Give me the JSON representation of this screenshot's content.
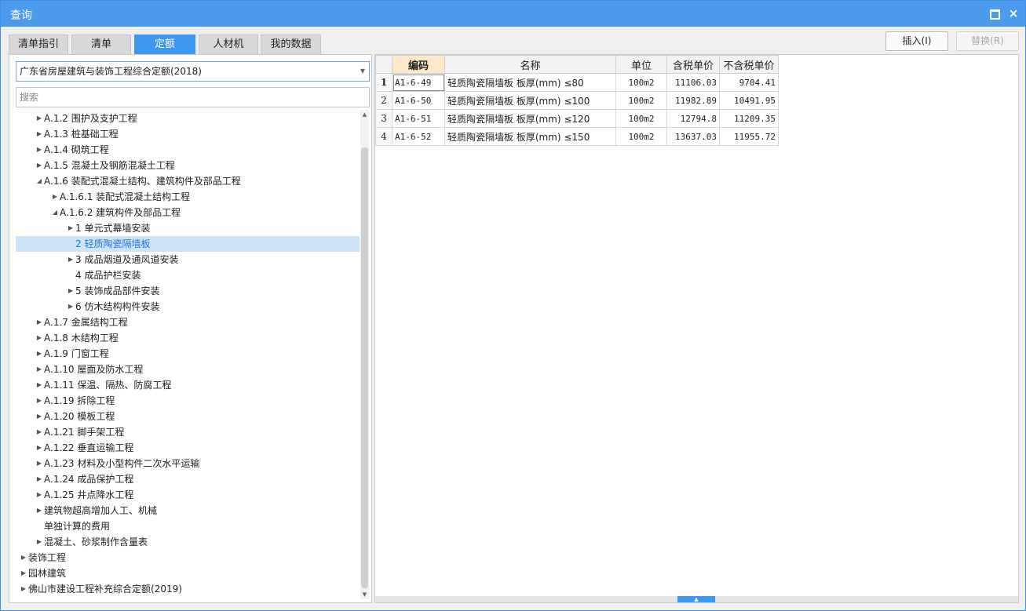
{
  "window": {
    "title": "查询",
    "close_glyph": "×"
  },
  "tabs": [
    {
      "label": "清单指引"
    },
    {
      "label": "清单"
    },
    {
      "label": "定额"
    },
    {
      "label": "人材机"
    },
    {
      "label": "我的数据"
    }
  ],
  "active_tab": "定额",
  "actions": {
    "insert_label": "插入(I)",
    "replace_label": "替换(R)"
  },
  "library": {
    "selected": "广东省房屋建筑与装饰工程综合定额(2018)"
  },
  "search": {
    "placeholder": "搜索",
    "value": ""
  },
  "tree": [
    {
      "label": "A.1.2 围护及支护工程",
      "level": 1,
      "toggle": "collapsed"
    },
    {
      "label": "A.1.3 桩基础工程",
      "level": 1,
      "toggle": "collapsed"
    },
    {
      "label": "A.1.4 砌筑工程",
      "level": 1,
      "toggle": "collapsed"
    },
    {
      "label": "A.1.5 混凝土及钢筋混凝土工程",
      "level": 1,
      "toggle": "collapsed"
    },
    {
      "label": "A.1.6 装配式混凝土结构、建筑构件及部品工程",
      "level": 1,
      "toggle": "expanded"
    },
    {
      "label": "A.1.6.1 装配式混凝土结构工程",
      "level": 2,
      "toggle": "collapsed"
    },
    {
      "label": "A.1.6.2 建筑构件及部品工程",
      "level": 2,
      "toggle": "expanded"
    },
    {
      "label": "1 单元式幕墙安装",
      "level": 3,
      "toggle": "collapsed"
    },
    {
      "label": "2 轻质陶瓷隔墙板",
      "level": 3,
      "toggle": "none",
      "selected": true
    },
    {
      "label": "3 成品烟道及通风道安装",
      "level": 3,
      "toggle": "collapsed"
    },
    {
      "label": "4 成品护栏安装",
      "level": 3,
      "toggle": "none"
    },
    {
      "label": "5 装饰成品部件安装",
      "level": 3,
      "toggle": "collapsed"
    },
    {
      "label": "6 仿木结构构件安装",
      "level": 3,
      "toggle": "collapsed"
    },
    {
      "label": "A.1.7 金属结构工程",
      "level": 1,
      "toggle": "collapsed"
    },
    {
      "label": "A.1.8 木结构工程",
      "level": 1,
      "toggle": "collapsed"
    },
    {
      "label": "A.1.9 门窗工程",
      "level": 1,
      "toggle": "collapsed"
    },
    {
      "label": "A.1.10 屋面及防水工程",
      "level": 1,
      "toggle": "collapsed"
    },
    {
      "label": "A.1.11 保温、隔热、防腐工程",
      "level": 1,
      "toggle": "collapsed"
    },
    {
      "label": "A.1.19 拆除工程",
      "level": 1,
      "toggle": "collapsed"
    },
    {
      "label": "A.1.20 模板工程",
      "level": 1,
      "toggle": "collapsed"
    },
    {
      "label": "A.1.21 脚手架工程",
      "level": 1,
      "toggle": "collapsed"
    },
    {
      "label": "A.1.22 垂直运输工程",
      "level": 1,
      "toggle": "collapsed"
    },
    {
      "label": "A.1.23 材料及小型构件二次水平运输",
      "level": 1,
      "toggle": "collapsed"
    },
    {
      "label": "A.1.24 成品保护工程",
      "level": 1,
      "toggle": "collapsed"
    },
    {
      "label": "A.1.25 井点降水工程",
      "level": 1,
      "toggle": "collapsed"
    },
    {
      "label": "建筑物超高增加人工、机械",
      "level": 1,
      "toggle": "collapsed"
    },
    {
      "label": "单独计算的费用",
      "level": 1,
      "toggle": "none"
    },
    {
      "label": "混凝土、砂浆制作含量表",
      "level": 1,
      "toggle": "collapsed"
    },
    {
      "label": "装饰工程",
      "level": 0,
      "toggle": "collapsed"
    },
    {
      "label": "园林建筑",
      "level": 0,
      "toggle": "collapsed"
    },
    {
      "label": "佛山市建设工程补充综合定额(2019)",
      "level": 0,
      "toggle": "collapsed"
    }
  ],
  "grid": {
    "columns": [
      "编码",
      "名称",
      "单位",
      "含税单价",
      "不含税单价"
    ],
    "rows": [
      {
        "no": "1",
        "code": "A1-6-49",
        "name": "轻质陶瓷隔墙板 板厚(mm) ≤80",
        "unit": "100m2",
        "price_tax": "11106.03",
        "price_notax": "9704.41",
        "current": true
      },
      {
        "no": "2",
        "code": "A1-6-50",
        "name": "轻质陶瓷隔墙板 板厚(mm) ≤100",
        "unit": "100m2",
        "price_tax": "11982.89",
        "price_notax": "10491.95"
      },
      {
        "no": "3",
        "code": "A1-6-51",
        "name": "轻质陶瓷隔墙板 板厚(mm) ≤120",
        "unit": "100m2",
        "price_tax": "12794.8",
        "price_notax": "11209.35"
      },
      {
        "no": "4",
        "code": "A1-6-52",
        "name": "轻质陶瓷隔墙板 板厚(mm) ≤150",
        "unit": "100m2",
        "price_tax": "13637.03",
        "price_notax": "11955.72"
      }
    ]
  },
  "colors": {
    "accent": "#3d96f0",
    "titlebar": "#4d9bef",
    "selection": "#cde3f8",
    "header_highlight": "#fde8c8"
  },
  "icons": {
    "maximize": "maximize-icon",
    "close": "close-icon",
    "dropdown": "chevron-down-icon",
    "expand": "triangle-right-icon",
    "collapse": "triangle-down-icon"
  }
}
